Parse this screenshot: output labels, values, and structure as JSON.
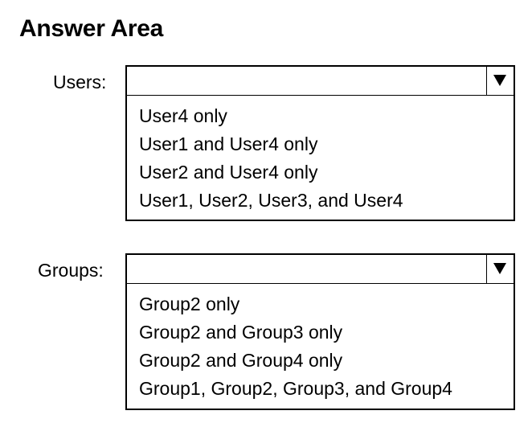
{
  "title": "Answer Area",
  "users": {
    "label": "Users:",
    "selected": "",
    "options": [
      "User4 only",
      "User1 and User4 only",
      "User2 and User4 only",
      "User1, User2, User3, and User4"
    ]
  },
  "groups": {
    "label": "Groups:",
    "selected": "",
    "options": [
      "Group2 only",
      "Group2 and Group3 only",
      "Group2 and Group4 only",
      "Group1, Group2, Group3, and Group4"
    ]
  },
  "icons": {
    "dropdown_arrow": "triangle-down-icon"
  }
}
